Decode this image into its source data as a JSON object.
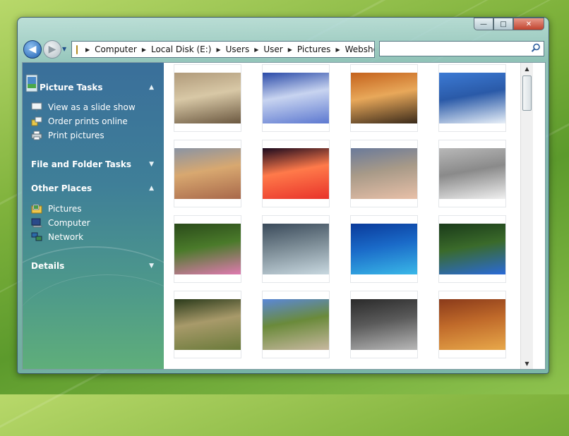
{
  "window": {
    "caption_buttons": {
      "minimize": "—",
      "maximize": "□",
      "close": "✕"
    }
  },
  "navigation": {
    "back_glyph": "◀",
    "forward_glyph": "▶",
    "dropdown_glyph": "▼",
    "breadcrumb": [
      "Computer",
      "Local Disk (E:)",
      "Users",
      "User",
      "Pictures",
      "Webshots"
    ],
    "separator": "▶",
    "search_placeholder": ""
  },
  "sidebar": {
    "picture_tasks": {
      "title": "Picture Tasks",
      "chevron": "▲",
      "items": [
        "View as a slide show",
        "Order prints online",
        "Print pictures"
      ]
    },
    "file_folder_tasks": {
      "title": "File and Folder Tasks",
      "chevron": "▼"
    },
    "other_places": {
      "title": "Other Places",
      "chevron": "▲",
      "items": [
        "Pictures",
        "Computer",
        "Network"
      ]
    },
    "details": {
      "title": "Details",
      "chevron": "▼"
    }
  },
  "thumbnails": [
    {
      "subject": "lion-cub",
      "colors": [
        "#b09a7a",
        "#6b5840",
        "#d8c8a6"
      ]
    },
    {
      "subject": "snowy-barn",
      "colors": [
        "#2a4aa8",
        "#5c78d0",
        "#c8d4f0"
      ]
    },
    {
      "subject": "tiger",
      "colors": [
        "#c4621c",
        "#3a2a1a",
        "#e8a85a"
      ]
    },
    {
      "subject": "penguins-iceberg",
      "colors": [
        "#3c7ad4",
        "#e8f0f8",
        "#2a5aa8"
      ]
    },
    {
      "subject": "elephants",
      "colors": [
        "#8a94a4",
        "#a8684a",
        "#d8a870"
      ]
    },
    {
      "subject": "red-sky-mountains",
      "colors": [
        "#1a0a1e",
        "#e8322a",
        "#ff7a4a"
      ]
    },
    {
      "subject": "mountain-beach",
      "colors": [
        "#6a7a9a",
        "#e8c0a8",
        "#a89a88"
      ]
    },
    {
      "subject": "arctic-fox",
      "colors": [
        "#b8b8b8",
        "#f0f0f0",
        "#8a8a8a"
      ]
    },
    {
      "subject": "flowers-forest",
      "colors": [
        "#2a4a1a",
        "#e07ab0",
        "#4a7a2a"
      ]
    },
    {
      "subject": "frozen-leaves",
      "colors": [
        "#3a4a5a",
        "#c8d8e0",
        "#7a8a94"
      ]
    },
    {
      "subject": "blue-hole",
      "colors": [
        "#0a3a9a",
        "#3ab8e8",
        "#1a6ac8"
      ]
    },
    {
      "subject": "blue-butterfly",
      "colors": [
        "#1a3a1a",
        "#2a6ad8",
        "#3a6a2a"
      ]
    },
    {
      "subject": "forest-path",
      "colors": [
        "#2a3a1a",
        "#6a7a3a",
        "#a89a6a"
      ]
    },
    {
      "subject": "mountain-lake",
      "colors": [
        "#5a88d8",
        "#c8b8a0",
        "#6a8a3a"
      ]
    },
    {
      "subject": "bubbles-ice",
      "colors": [
        "#2a2a2a",
        "#b8b8b8",
        "#5a5a5a"
      ]
    },
    {
      "subject": "dome-ceiling",
      "colors": [
        "#8a3a1a",
        "#e8a84a",
        "#c06a2a"
      ]
    }
  ],
  "scrollbar": {
    "up": "▲",
    "down": "▼"
  }
}
